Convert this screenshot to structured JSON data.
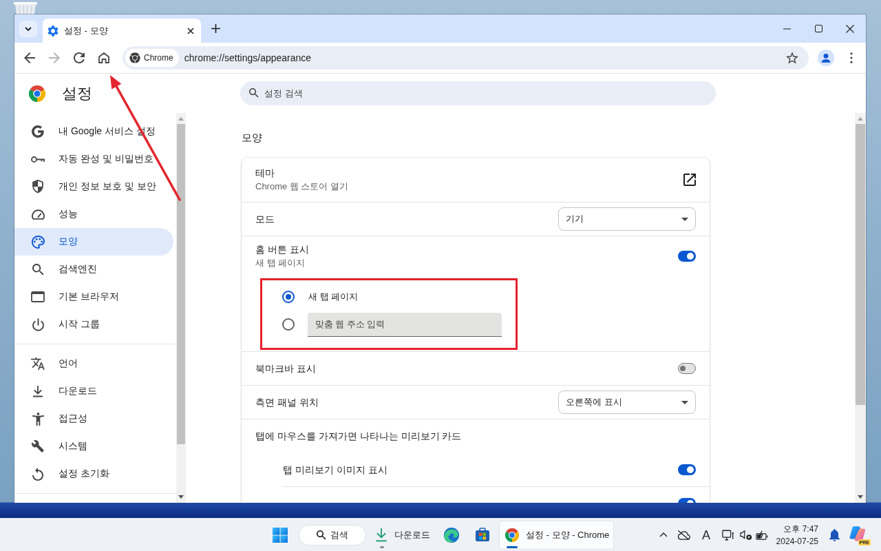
{
  "browser": {
    "tabs": [
      {
        "title": "설정 - 모양",
        "selected": true
      }
    ],
    "nav_buttons": [
      {
        "kind": "back",
        "disabled": false,
        "callout": false
      },
      {
        "kind": "forward",
        "disabled": true,
        "callout": false
      },
      {
        "kind": "reload",
        "disabled": false,
        "callout": false
      },
      {
        "kind": "home",
        "disabled": false,
        "callout": true
      }
    ],
    "omnibox": {
      "chip": "Chrome",
      "url": "chrome://settings/appearance"
    }
  },
  "settings": {
    "title": "설정",
    "search": {
      "placeholder": "설정 검색"
    },
    "sidebar": {
      "groups": [
        {
          "items": [
            {
              "label": "내 Google 서비스 설정",
              "selected": false
            },
            {
              "label": "자동 완성 및 비밀번호",
              "selected": false
            },
            {
              "label": "개인 정보 보호 및 보안",
              "selected": false
            },
            {
              "label": "성능",
              "selected": false
            },
            {
              "label": "모양",
              "selected": true
            },
            {
              "label": "검색엔진",
              "selected": false
            },
            {
              "label": "기본 브라우저",
              "selected": false
            },
            {
              "label": "시작 그룹",
              "selected": false
            }
          ]
        },
        {
          "items": [
            {
              "label": "언어",
              "selected": false
            },
            {
              "label": "다운로드",
              "selected": false
            },
            {
              "label": "접근성",
              "selected": false
            },
            {
              "label": "시스템",
              "selected": false
            },
            {
              "label": "설정 초기화",
              "selected": false
            }
          ]
        }
      ]
    },
    "section": {
      "title": "모양",
      "rows": [
        {
          "kind": "link",
          "label": "테마",
          "description": "Chrome 웹 스토어 열기"
        },
        {
          "kind": "dropdown",
          "label": "모드",
          "value": "기기"
        },
        {
          "kind": "toggle",
          "label": "홈 버튼 표시",
          "description": "새 탭 페이지",
          "on": true,
          "options_framed": true,
          "options": [
            {
              "kind": "radio",
              "label": "새 탭 페이지",
              "selected": true
            },
            {
              "kind": "url",
              "placeholder": "맞춤 웹 주소 입력",
              "selected": false
            }
          ]
        },
        {
          "kind": "toggle",
          "label": "북마크바 표시",
          "on": false
        },
        {
          "kind": "dropdown",
          "label": "측면 패널 위치",
          "value": "오른쪽에 표시"
        },
        {
          "kind": "group",
          "label": "탭에 마우스를 가져가면 나타나는 미리보기 카드",
          "children": [
            {
              "kind": "toggle",
              "label": "탭 미리보기 이미지 표시",
              "on": true
            },
            {
              "kind": "toggle",
              "on": true
            }
          ]
        }
      ]
    }
  },
  "taskbar": {
    "search": "검색",
    "apps": [
      {
        "label": "다운로드",
        "running": true,
        "selected": false
      },
      {
        "running": false,
        "selected": false
      },
      {
        "running": false,
        "selected": false
      },
      {
        "label": "설정 - 모양 - Chrome",
        "running": true,
        "selected": true
      }
    ],
    "ime": "A",
    "clock": {
      "time": "오후 7:47",
      "date": "2024-07-25"
    },
    "copilot": {
      "badge": "PRE"
    }
  }
}
